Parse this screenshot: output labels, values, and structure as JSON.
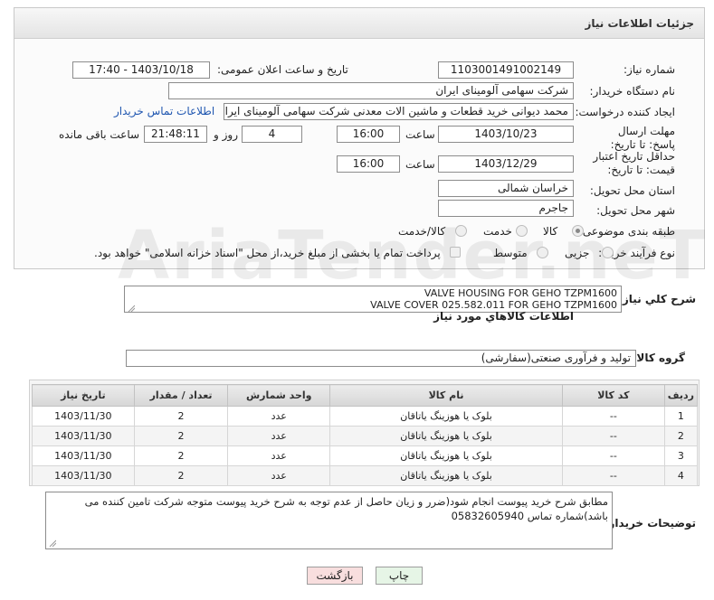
{
  "panel": {
    "title": "جزئیات اطلاعات نیاز"
  },
  "labels": {
    "need_number": "شماره نیاز:",
    "announce_datetime": "تاریخ و ساعت اعلان عمومی:",
    "buyer_org": "نام دستگاه خریدار:",
    "requester": "ایجاد کننده درخواست:",
    "reply_deadline": "مهلت ارسال پاسخ: تا تاریخ:",
    "price_validity": "حداقل تاریخ اعتبار قیمت: تا تاریخ:",
    "delivery_province": "استان محل تحویل:",
    "delivery_city": "شهر محل تحویل:",
    "category": "طبقه بندی موضوعی:",
    "purchase_type": "نوع فرآیند خرید :",
    "time": "ساعت",
    "day_and": "روز و",
    "remaining": "ساعت باقی مانده",
    "general_desc": "شرح کلي نیاز:",
    "goods_info": "اطلاعات کالاهاي مورد نیاز",
    "goods_group": "گروه کالا:",
    "buyer_notes": "توضیحات خریدار:"
  },
  "values": {
    "need_number": "1103001491002149",
    "announce_datetime": "1403/10/18 - 17:40",
    "buyer_org": "شرکت سهامی آلومینای ایران",
    "requester": "محمد دیوانی خرید قطعات و ماشین الات معدنی شرکت سهامی آلومینای ایران",
    "contact_link": "اطلاعات تماس خریدار",
    "reply_date": "1403/10/23",
    "reply_time": "16:00",
    "days": "4",
    "remaining_time": "21:48:11",
    "validity_date": "1403/12/29",
    "validity_time": "16:00",
    "province": "خراسان شمالی",
    "city": "جاجرم",
    "desc_line1": "VALVE HOUSING  FOR GEHO TZPM1600",
    "desc_line2": "VALVE COVER 025.582.011 FOR GEHO TZPM1600",
    "goods_group": "تولید و فرآوری صنعتی(سفارشی)",
    "notes": "مطابق شرح خرید پیوست انجام شود(ضرر و زیان حاصل از عدم توجه به شرح خرید پیوست متوجه شرکت تامین کننده می باشد)شماره تماس 05832605940"
  },
  "options": {
    "category": [
      {
        "label": "کالا",
        "selected": true
      },
      {
        "label": "خدمت",
        "selected": false
      },
      {
        "label": "کالا/خدمت",
        "selected": false
      }
    ],
    "purchase": [
      {
        "label": "جزیی",
        "selected": false
      },
      {
        "label": "متوسط",
        "selected": false
      }
    ],
    "payment_note": "پرداخت تمام یا بخشی از مبلغ خرید،از محل \"اسناد خزانه اسلامی\" خواهد بود."
  },
  "table": {
    "headers": [
      "ردیف",
      "کد کالا",
      "نام کالا",
      "واحد شمارش",
      "تعداد / مقدار",
      "تاریخ نیاز"
    ],
    "rows": [
      [
        "1",
        "--",
        "بلوک یا هوزینگ یاتاقان",
        "عدد",
        "2",
        "1403/11/30"
      ],
      [
        "2",
        "--",
        "بلوک یا هوزینگ یاتاقان",
        "عدد",
        "2",
        "1403/11/30"
      ],
      [
        "3",
        "--",
        "بلوک یا هوزینگ یاتاقان",
        "عدد",
        "2",
        "1403/11/30"
      ],
      [
        "4",
        "--",
        "بلوک یا هوزینگ یاتاقان",
        "عدد",
        "2",
        "1403/11/30"
      ]
    ]
  },
  "buttons": {
    "print": "چاپ",
    "back": "بازگشت"
  },
  "watermark": "AriaTender.neT",
  "colors": {
    "header_bg": "#e4e4e4",
    "link": "#1f56b0",
    "back_button": "#f8dede",
    "print_button": "#e6f5e6"
  }
}
